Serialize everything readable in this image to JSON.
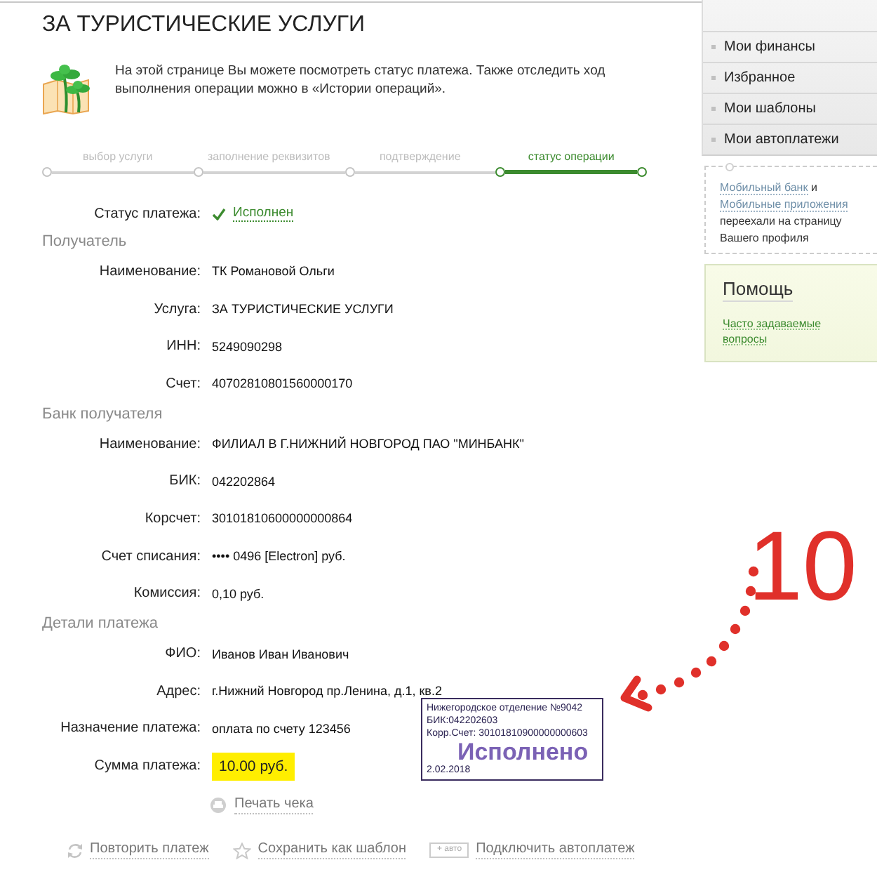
{
  "page": {
    "title": "ЗА ТУРИСТИЧЕСКИЕ УСЛУГИ",
    "intro": "На этой странице Вы можете посмотреть статус платежа. Также отследить ход выполнения операции можно в «Истории операций»."
  },
  "steps": [
    {
      "label": "выбор услуги",
      "selected": false
    },
    {
      "label": "заполнение реквизитов",
      "selected": false
    },
    {
      "label": "подтверждение",
      "selected": false
    },
    {
      "label": "статус операции",
      "selected": true
    }
  ],
  "status": {
    "label": "Статус платежа:",
    "value": "Исполнен"
  },
  "sections": [
    {
      "title": "Получатель",
      "rows": [
        {
          "kind": "plain",
          "label": "Наименование:",
          "value": "ТК Романовой Ольги"
        },
        {
          "kind": "plain",
          "label": "Услуга:",
          "value": "ЗА ТУРИСТИЧЕСКИЕ УСЛУГИ"
        },
        {
          "kind": "plain",
          "label": "ИНН:",
          "value": "5249090298"
        },
        {
          "kind": "plain",
          "label": "Счет:",
          "value": "40702810801560000170"
        }
      ]
    },
    {
      "title": "Банк получателя",
      "rows": [
        {
          "kind": "plain",
          "label": "Наименование:",
          "value": "ФИЛИАЛ В Г.НИЖНИЙ НОВГОРОД ПАО \"МИНБАНК\""
        },
        {
          "kind": "plain",
          "label": "БИК:",
          "value": "042202864"
        },
        {
          "kind": "plain",
          "label": "Корсчет:",
          "value": "30101810600000000864"
        },
        {
          "kind": "plain",
          "label": "Счет списания:",
          "value": "•••• 0496 [Electron] руб."
        },
        {
          "kind": "plain",
          "label": "Комиссия:",
          "value": "0,10 руб."
        }
      ]
    },
    {
      "title": "Детали платежа",
      "rows": [
        {
          "kind": "plain",
          "label": "ФИО:",
          "value": "Иванов Иван Иванович"
        },
        {
          "kind": "plain",
          "label": "Адрес:",
          "value": "г.Нижний Новгород пр.Ленина, д.1, кв.2"
        },
        {
          "kind": "plain",
          "label": "Назначение платежа:",
          "value": "оплата по счету 123456"
        },
        {
          "kind": "amount",
          "label": "Сумма платежа:",
          "value": "10.00 руб."
        }
      ]
    }
  ],
  "print": {
    "label": "Печать чека"
  },
  "actions": [
    {
      "kind": "repeat",
      "label": "Повторить платеж"
    },
    {
      "kind": "template",
      "label": "Сохранить как шаблон"
    },
    {
      "kind": "autopay",
      "badge": "+ авто",
      "label": "Подключить автоплатеж"
    }
  ],
  "stamp": {
    "lines": [
      "Нижегородское отделение №9042",
      "БИК:042202603",
      "Корр.Счет: 30101810900000000603"
    ],
    "status": "Исполнено",
    "date": "2.02.2018"
  },
  "annotation": {
    "number": "10"
  },
  "sidebar": {
    "menu": [
      "Мои финансы",
      "Избранное",
      "Мои шаблоны",
      "Мои автоплатежи"
    ],
    "notice": [
      {
        "kind": "link",
        "text": "Мобильный банк"
      },
      {
        "kind": "text",
        "text": " и "
      },
      {
        "kind": "link",
        "text": "Мобильные приложения"
      },
      {
        "kind": "text",
        "text": " переехали на страницу Вашего профиля"
      }
    ],
    "help": {
      "title": "Помощь",
      "link": "Часто задаваемые вопросы"
    }
  }
}
